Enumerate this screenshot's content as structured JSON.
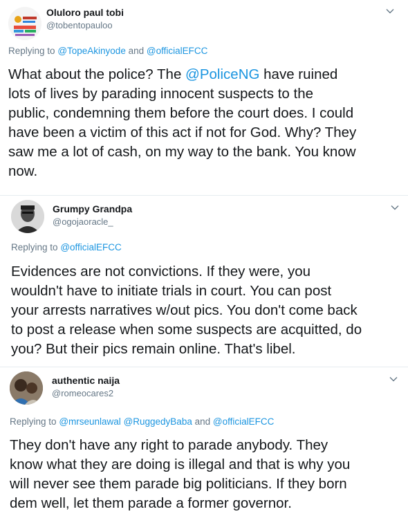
{
  "tweets": [
    {
      "display_name": "Oluloro paul tobi",
      "handle": "@tobentopauloo",
      "replying_prefix": "Replying to",
      "replying_to": [
        "@TopeAkinyode",
        "@officialEFCC"
      ],
      "replying_join": "and",
      "body_lines": [
        {
          "pre": "What about the police? The ",
          "mention": "@PoliceNG",
          "post": " have ruined"
        },
        {
          "pre": "lots of  lives by parading innocent suspects to the"
        },
        {
          "pre": "public, condemning them before the court does. I could"
        },
        {
          "pre": "have been a victim of this act if not for God. Why? They"
        },
        {
          "pre": "saw me a lot of cash, on my way to the bank. You know"
        },
        {
          "pre": "now."
        }
      ]
    },
    {
      "display_name": "Grumpy Grandpa",
      "handle": "@ogojaoracle_",
      "replying_prefix": "Replying to",
      "replying_to": [
        "@officialEFCC"
      ],
      "body_lines": [
        {
          "pre": "Evidences are not convictions. If they were, you"
        },
        {
          "pre": "wouldn't have to initiate trials in court. You can post"
        },
        {
          "pre": "your arrests narratives w/out pics. You don't come back"
        },
        {
          "pre": "to post a release when some suspects are acquitted, do"
        },
        {
          "pre": "you? But their pics remain online. That's libel."
        }
      ]
    },
    {
      "display_name": "authentic naija",
      "handle": "@romeocares2",
      "replying_prefix": "Replying to",
      "replying_to": [
        "@mrseunlawal",
        "@RuggedyBaba",
        "@officialEFCC"
      ],
      "replying_join": "and",
      "body_lines": [
        {
          "pre": "They don't have any right to parade anybody. They"
        },
        {
          "pre": "know what they are doing is illegal and that is why you"
        },
        {
          "pre": "will never see them parade big politicians. If they born"
        },
        {
          "pre": "dem well, let them parade a former governor."
        }
      ]
    }
  ],
  "icons": {
    "menu": "chevron-down-icon"
  },
  "colors": {
    "mention": "#1b95e0",
    "secondary_text": "#657786",
    "divider": "#e6ecf0",
    "text": "#14171a"
  }
}
